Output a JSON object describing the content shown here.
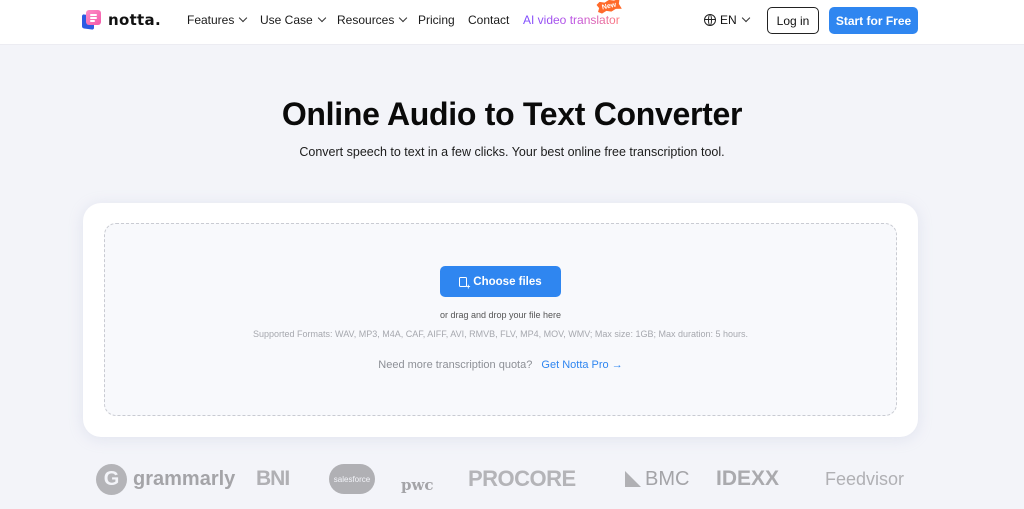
{
  "nav": {
    "logo_text": "notta.",
    "items": [
      {
        "label": "Features",
        "has_dropdown": true
      },
      {
        "label": "Use Case",
        "has_dropdown": true
      },
      {
        "label": "Resources",
        "has_dropdown": true
      },
      {
        "label": "Pricing",
        "has_dropdown": false
      },
      {
        "label": "Contact",
        "has_dropdown": false
      },
      {
        "label": "AI video translator",
        "has_dropdown": false
      }
    ],
    "new_badge": "New",
    "language": "EN",
    "login_label": "Log in",
    "start_label": "Start for Free"
  },
  "hero": {
    "title": "Online Audio to Text Converter",
    "subtitle": "Convert speech to text in a few clicks. Your best online free transcription tool."
  },
  "uploader": {
    "choose_label": "Choose files",
    "drag_text": "or drag and drop your file here",
    "formats_text": "Supported Formats: WAV, MP3, M4A, CAF, AIFF, AVI, RMVB, FLV, MP4, MOV, WMV; Max size: 1GB; Max duration: 5 hours.",
    "quota_text": "Need more transcription quota?",
    "pro_link": "Get Notta Pro →"
  },
  "logos": {
    "grammarly": "grammarly",
    "grammarly_mark": "G",
    "bni": "BNI",
    "salesforce": "salesforce",
    "pwc": "pwc",
    "procore": "PROCORE",
    "bmc": "BMC",
    "idexx": "IDEXX",
    "feedvisor": "Feedvisor"
  },
  "colors": {
    "accent": "#2f86f0",
    "background": "#f3f4f9",
    "new_badge": "#ff6a2b"
  }
}
